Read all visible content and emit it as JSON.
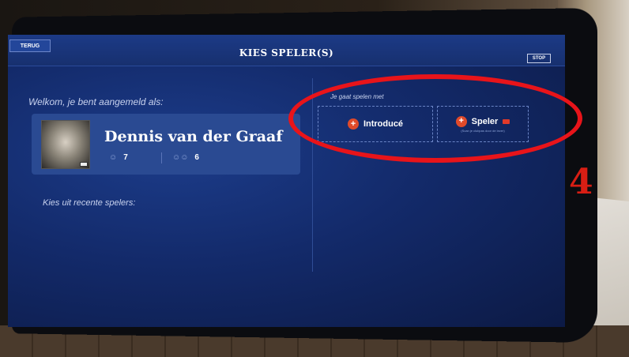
{
  "header": {
    "back_label": "TERUG",
    "title": "KIES SPELER(S)",
    "stop_label": "STOP"
  },
  "welcome_text": "Welkom, je bent aangemeld als:",
  "player": {
    "name": "Dennis van der Graaf",
    "stat_single": "7",
    "stat_group": "6"
  },
  "play_with": {
    "label": "Je gaat spelen met",
    "introduce_label": "Introducé",
    "player_label": "Speler",
    "player_sub": "(Scan je clubpas door de lezer)"
  },
  "recent_label": "Kies uit recente spelers:",
  "annotation": {
    "marker": "4",
    "color": "#e8141a"
  },
  "colors": {
    "accent": "#e04a2a",
    "screen_bg": "#132a6a"
  }
}
